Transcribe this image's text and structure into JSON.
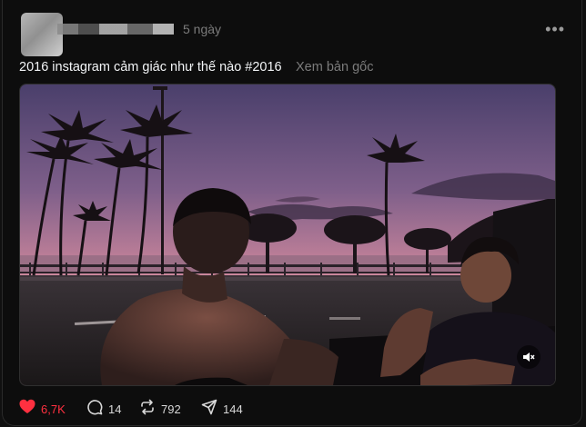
{
  "post": {
    "time": "5 ngày",
    "caption": "2016 instagram cảm giác như thế nào #2016",
    "translate": "Xem bản gốc",
    "more_icon": "more-horizontal-icon"
  },
  "video": {
    "mute_icon": "speaker-muted-icon"
  },
  "actions": {
    "likes": "6,7K",
    "comments": "14",
    "reposts": "792",
    "shares": "144",
    "like_color": "#ff3040",
    "icons": [
      "heart-filled-icon",
      "comment-bubble-icon",
      "repost-icon",
      "share-paper-plane-icon"
    ]
  }
}
